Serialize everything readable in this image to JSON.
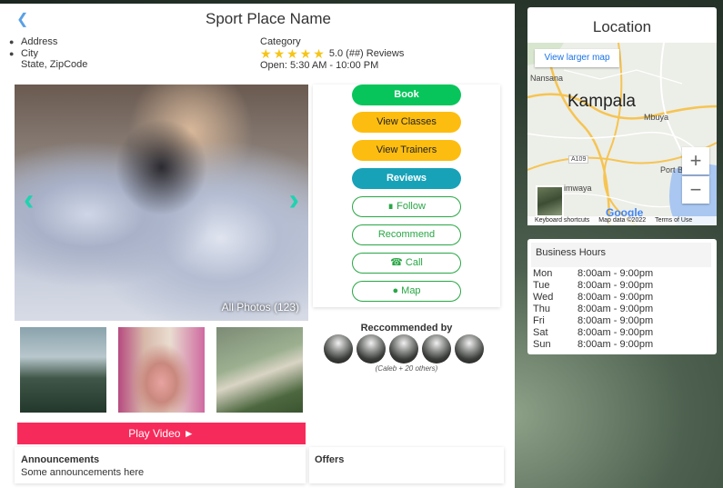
{
  "header": {
    "back_icon": "chevron-left-icon",
    "title": "Sport Place Name"
  },
  "address": {
    "line1": "Address",
    "line2": "City",
    "line3": "State, ZipCode"
  },
  "info": {
    "category": "Category",
    "rating_value": 5.0,
    "rating_text": "5.0 (##) Reviews",
    "stars": [
      "★",
      "★",
      "★",
      "★",
      "★"
    ],
    "hours": "Open: 5:30 AM - 10:00 PM"
  },
  "gallery": {
    "prev_icon": "‹",
    "next_icon": "›",
    "all_photos": "All Photos (123)"
  },
  "actions": {
    "book": "Book",
    "view_classes": "View Classes",
    "view_trainers": "View Trainers",
    "reviews": "Reviews",
    "follow": "Follow",
    "recommend": "Recommend",
    "call": "Call",
    "map": "Map"
  },
  "recommended": {
    "title": "Reccommended by",
    "note": "(Caleb + 20 others)"
  },
  "play_video": "Play Video",
  "announcements": {
    "title": "Announcements",
    "text": "Some announcements here"
  },
  "offers": {
    "title": "Offers"
  },
  "location": {
    "title": "Location",
    "larger_map": "View larger map",
    "city": "Kampala",
    "labels": {
      "nansana": "Nansana",
      "mbuya": "Mbuya",
      "port_bell": "Port B",
      "road": "A109",
      "mwaya": "imwaya"
    },
    "zoom_in": "+",
    "zoom_out": "−",
    "google": "Google",
    "shortcuts": "Keyboard shortcuts",
    "map_data": "Map data ©2022",
    "terms": "Terms of Use"
  },
  "business_hours": {
    "title": "Business Hours",
    "days": [
      {
        "day": "Mon",
        "hours": "8:00am - 9:00pm"
      },
      {
        "day": "Tue",
        "hours": "8:00am - 9:00pm"
      },
      {
        "day": "Wed",
        "hours": "8:00am - 9:00pm"
      },
      {
        "day": "Thu",
        "hours": "8:00am - 9:00pm"
      },
      {
        "day": "Fri",
        "hours": "8:00am - 9:00pm"
      },
      {
        "day": "Sat",
        "hours": "8:00am - 9:00pm"
      },
      {
        "day": "Sun",
        "hours": "8:00am - 9:00pm"
      }
    ]
  },
  "colors": {
    "green": "#08c55b",
    "yellow": "#fdbd10",
    "teal": "#17a2b8",
    "outline_green": "#28a745",
    "play_red": "#f72b5b",
    "caret": "#1fd3b0"
  }
}
